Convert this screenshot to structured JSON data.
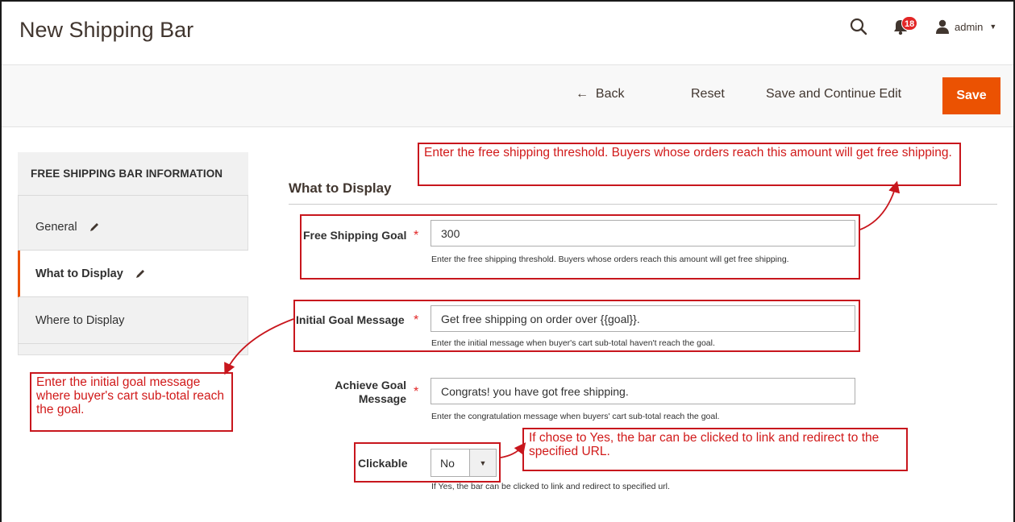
{
  "header": {
    "title": "New Shipping Bar",
    "notification_count": "18",
    "user": "admin"
  },
  "actions": {
    "back": "Back",
    "reset": "Reset",
    "save_continue": "Save and Continue Edit",
    "save": "Save"
  },
  "sidebar": {
    "title": "FREE SHIPPING BAR INFORMATION",
    "items": [
      {
        "label": "General"
      },
      {
        "label": "What to Display"
      },
      {
        "label": "Where to Display"
      }
    ]
  },
  "section": {
    "title": "What to Display"
  },
  "fields": {
    "goal": {
      "label": "Free Shipping Goal",
      "value": "300",
      "note": "Enter the free shipping threshold. Buyers whose orders reach this amount will get free shipping."
    },
    "initial": {
      "label": "Initial Goal Message",
      "value": "Get free shipping on order over {{goal}}.",
      "note": "Enter the initial message when buyer's cart sub-total haven't reach the goal."
    },
    "achieve": {
      "label_line1": "Achieve Goal",
      "label_line2": "Message",
      "value": "Congrats! you have got free shipping.",
      "note": "Enter the congratulation message when buyers' cart sub-total reach the goal."
    },
    "clickable": {
      "label": "Clickable",
      "value": "No",
      "note": "If Yes, the bar can be clicked to link and redirect to specified url."
    }
  },
  "annotations": {
    "goal": "Enter the free shipping threshold. Buyers whose orders reach this amount will get free shipping.",
    "initial": "Enter the initial goal message where buyer's cart sub-total reach the goal.",
    "clickable": "If chose to Yes, the bar can be clicked to link and redirect to the specified URL."
  },
  "colors": {
    "accent": "#eb5202",
    "annotation": "#c8161d",
    "badge": "#e22626"
  }
}
